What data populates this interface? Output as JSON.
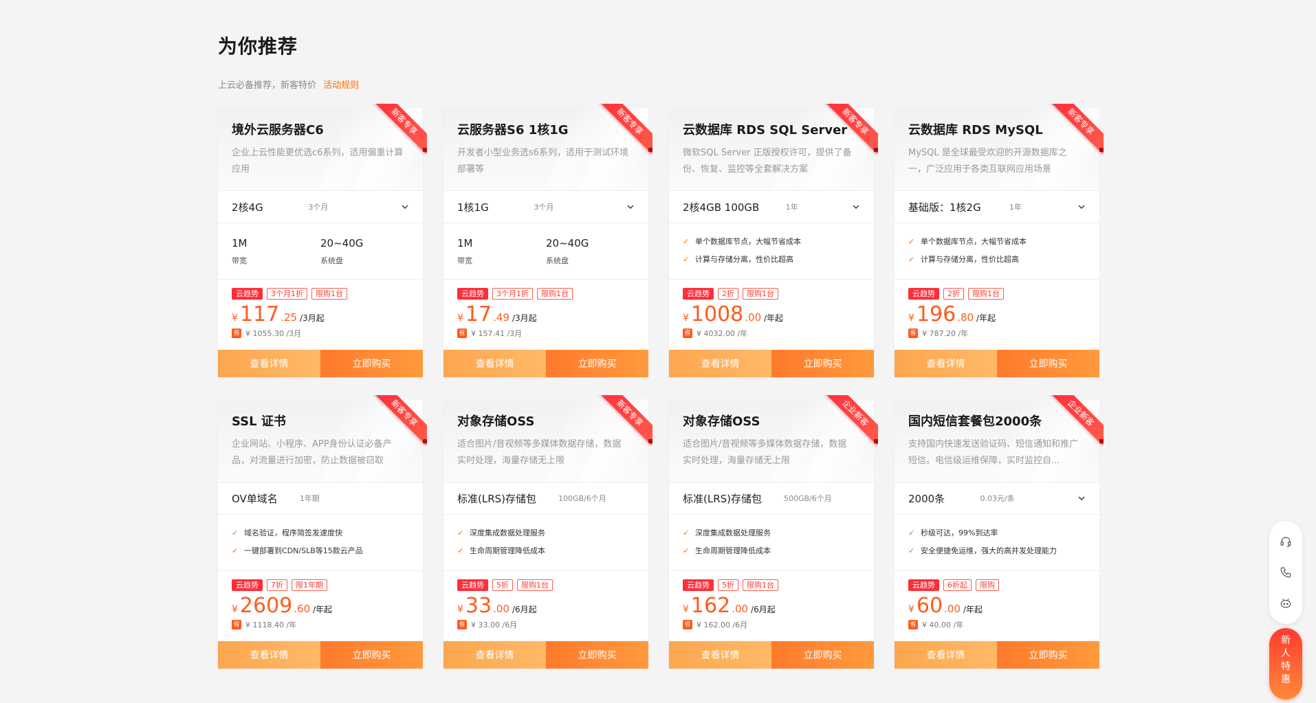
{
  "header": {
    "title": "为你推荐",
    "subtitle": "上云必备推荐，新客特价",
    "rules_link": "活动规则"
  },
  "buttons": {
    "detail": "查看详情",
    "buy": "立即购买"
  },
  "save_badge": "省",
  "yen": "¥",
  "cards": [
    {
      "ribbon": "新客专享",
      "title": "境外云服务器C6",
      "desc": "企业上云性能更优选c6系列，适用偏重计算应用",
      "spec": "2核4G",
      "period": "3个月",
      "stats": [
        {
          "value": "1M",
          "label": "带宽"
        },
        {
          "value": "20~40G",
          "label": "系统盘"
        }
      ],
      "tags": [
        "云趋势",
        "3个月1折",
        "限购1台"
      ],
      "price_int": "117",
      "price_dec": ".25",
      "price_unit": "/3月起",
      "orig": "¥ 1055.30 /3月"
    },
    {
      "ribbon": "新客专享",
      "title": "云服务器S6 1核1G",
      "desc": "开发者小型业务选s6系列，适用于测试环境部署等",
      "spec": "1核1G",
      "period": "3个月",
      "stats": [
        {
          "value": "1M",
          "label": "带宽"
        },
        {
          "value": "20~40G",
          "label": "系统盘"
        }
      ],
      "tags": [
        "云趋势",
        "3个月1折",
        "限购1台"
      ],
      "price_int": "17",
      "price_dec": ".49",
      "price_unit": "/3月起",
      "orig": "¥ 157.41 /3月"
    },
    {
      "ribbon": "新客专享",
      "title": "云数据库 RDS SQL Server",
      "desc": "微软SQL Server 正版授权许可，提供了备份、恢复、监控等全套解决方案",
      "spec": "2核4GB 100GB",
      "period": "1年",
      "features": [
        "单个数据库节点，大幅节省成本",
        "计算与存储分离，性价比超高"
      ],
      "tags": [
        "云趋势",
        "2折",
        "限购1台"
      ],
      "price_int": "1008",
      "price_dec": ".00",
      "price_unit": "/年起",
      "orig": "¥ 4032.00 /年"
    },
    {
      "ribbon": "新客专享",
      "title": "云数据库 RDS MySQL",
      "desc": "MySQL 是全球最受欢迎的开源数据库之一，广泛应用于各类互联网应用场景",
      "spec": "基础版：1核2G",
      "period": "1年",
      "features": [
        "单个数据库节点，大幅节省成本",
        "计算与存储分离，性价比超高"
      ],
      "tags": [
        "云趋势",
        "2折",
        "限购1台"
      ],
      "price_int": "196",
      "price_dec": ".80",
      "price_unit": "/年起",
      "orig": "¥ 787.20 /年"
    },
    {
      "ribbon": "新客专享",
      "title": "SSL 证书",
      "desc": "企业网站、小程序、APP身份认证必备产品，对流量进行加密，防止数据被窃取",
      "spec": "OV单域名",
      "period": "1年期",
      "features": [
        "域名验证，程序简签发速度快",
        "一键部署到CDN/SLB等15款云产品"
      ],
      "tags": [
        "云趋势",
        "7折",
        "限1年期"
      ],
      "price_int": "2609",
      "price_dec": ".60",
      "price_unit": "/年起",
      "orig": "¥ 1118.40 /年"
    },
    {
      "ribbon": "新客专享",
      "title": "对象存储OSS",
      "desc": "适合图片/音视频等多媒体数据存储，数据实时处理，海量存储无上限",
      "spec": "标准(LRS)存储包",
      "period": "100GB/6个月",
      "features": [
        "深度集成数据处理服务",
        "生命周期管理降低成本"
      ],
      "tags": [
        "云趋势",
        "5折",
        "限购1台"
      ],
      "price_int": "33",
      "price_dec": ".00",
      "price_unit": "/6月起",
      "orig": "¥ 33.00 /6月"
    },
    {
      "ribbon": "企业新客",
      "title": "对象存储OSS",
      "desc": "适合图片/音视频等多媒体数据存储，数据实时处理，海量存储无上限",
      "spec": "标准(LRS)存储包",
      "period": "500GB/6个月",
      "features": [
        "深度集成数据处理服务",
        "生命周期管理降低成本"
      ],
      "tags": [
        "云趋势",
        "5折",
        "限购1台"
      ],
      "price_int": "162",
      "price_dec": ".00",
      "price_unit": "/6月起",
      "orig": "¥ 162.00 /6月"
    },
    {
      "ribbon": "企业新客",
      "title": "国内短信套餐包2000条",
      "desc": "支持国内快速发送验证码、短信通知和推广短信。电信级运维保障，实时监控自...",
      "spec": "2000条",
      "period": "0.03元/条",
      "features": [
        "秒级可达，99%到达率",
        "安全便捷免运维，强大的高并发处理能力"
      ],
      "tags": [
        "云趋势",
        "6折起",
        "限购"
      ],
      "price_int": "60",
      "price_dec": ".00",
      "price_unit": "/年起",
      "orig": "¥ 40.00 /年"
    }
  ],
  "float": {
    "newbie": [
      "新",
      "人",
      "特",
      "惠"
    ],
    "tools": [
      "headset-icon",
      "phone-icon",
      "chat-bot-icon"
    ]
  }
}
